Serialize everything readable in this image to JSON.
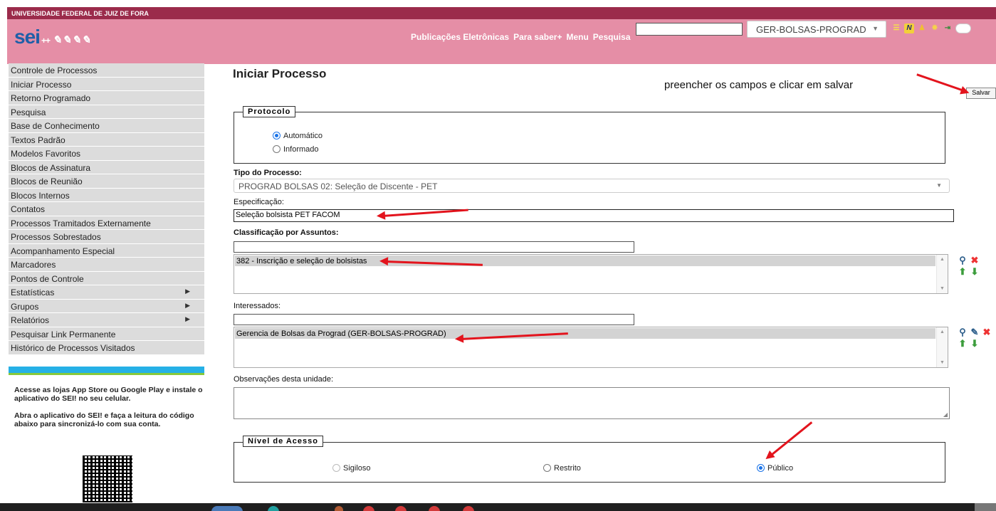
{
  "header": {
    "institution": "UNIVERSIDADE FEDERAL DE JUIZ DE FORA",
    "logo": "sei",
    "logo_suffix": "++",
    "nav": [
      "Publicações Eletrônicas",
      "Para saber+",
      "Menu",
      "Pesquisa"
    ],
    "search_value": "",
    "unit_select": "GER-BOLSAS-PROGRAD",
    "icons": [
      "list-icon",
      "notes-icon",
      "users-icon",
      "sun-icon",
      "exit-icon",
      "theme-toggle-icon"
    ]
  },
  "sidebar": {
    "items": [
      {
        "label": "Controle de Processos",
        "submenu": false
      },
      {
        "label": "Iniciar Processo",
        "submenu": false
      },
      {
        "label": "Retorno Programado",
        "submenu": false
      },
      {
        "label": "Pesquisa",
        "submenu": false
      },
      {
        "label": "Base de Conhecimento",
        "submenu": false
      },
      {
        "label": "Textos Padrão",
        "submenu": false
      },
      {
        "label": "Modelos Favoritos",
        "submenu": false
      },
      {
        "label": "Blocos de Assinatura",
        "submenu": false
      },
      {
        "label": "Blocos de Reunião",
        "submenu": false
      },
      {
        "label": "Blocos Internos",
        "submenu": false
      },
      {
        "label": "Contatos",
        "submenu": false
      },
      {
        "label": "Processos Tramitados Externamente",
        "submenu": false
      },
      {
        "label": "Processos Sobrestados",
        "submenu": false
      },
      {
        "label": "Acompanhamento Especial",
        "submenu": false
      },
      {
        "label": "Marcadores",
        "submenu": false
      },
      {
        "label": "Pontos de Controle",
        "submenu": false
      },
      {
        "label": "Estatísticas",
        "submenu": true
      },
      {
        "label": "Grupos",
        "submenu": true
      },
      {
        "label": "Relatórios",
        "submenu": true
      },
      {
        "label": "Pesquisar Link Permanente",
        "submenu": false
      },
      {
        "label": "Histórico de Processos Visitados",
        "submenu": false
      }
    ],
    "app_text_1": "Acesse as lojas App Store ou Google Play e instale o aplicativo do SEI! no seu celular.",
    "app_text_2": "Abra o aplicativo do SEI! e faça a leitura do código abaixo para sincronizá-lo com sua conta."
  },
  "form": {
    "title": "Iniciar Processo",
    "annotation": "preencher os campos e clicar em salvar",
    "save_label": "Salvar",
    "protocolo": {
      "legend": "Protocolo",
      "options": [
        "Automático",
        "Informado"
      ],
      "selected": "Automático"
    },
    "tipo_label": "Tipo do Processo:",
    "tipo_value": "PROGRAD BOLSAS 02: Seleção de Discente - PET",
    "especificacao_label": "Especificação:",
    "especificacao_value": "Seleção bolsista PET FACOM",
    "classificacao_label": "Classificação por Assuntos:",
    "classificacao_input": "",
    "classificacao_items": [
      "382 - Inscrição e seleção de bolsistas"
    ],
    "interessados_label": "Interessados:",
    "interessados_input": "",
    "interessados_items": [
      "Gerencia de Bolsas da Prograd (GER-BOLSAS-PROGRAD)"
    ],
    "observacoes_label": "Observações desta unidade:",
    "observacoes_value": "",
    "nivel": {
      "legend": "Nível de Acesso",
      "options": [
        "Sigiloso",
        "Restrito",
        "Público"
      ],
      "selected": "Público"
    }
  },
  "colors": {
    "header_bg": "#e58ea6",
    "header_strip": "#9b2b4b",
    "sidebar_item": "#dcdcdc",
    "annotation_arrow": "#e3141d",
    "radio_accent": "#1a73e8"
  }
}
